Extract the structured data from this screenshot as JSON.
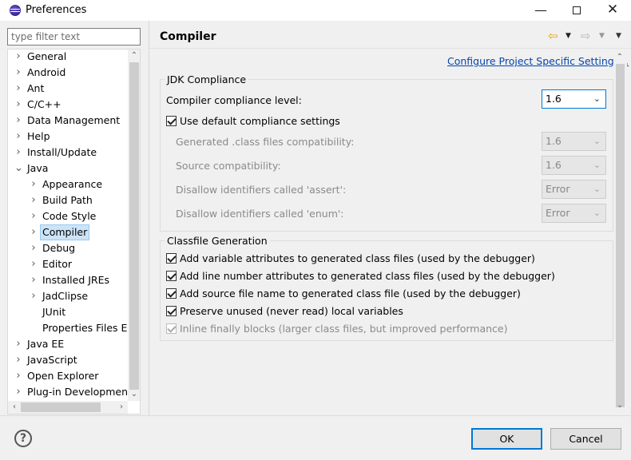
{
  "window": {
    "title": "Preferences",
    "minimize": "—",
    "close": "✕"
  },
  "filter": {
    "placeholder": "type filter text"
  },
  "tree": {
    "items": [
      {
        "label": "General",
        "level": 0,
        "expander": "collapsed"
      },
      {
        "label": "Android",
        "level": 0,
        "expander": "collapsed"
      },
      {
        "label": "Ant",
        "level": 0,
        "expander": "collapsed"
      },
      {
        "label": "C/C++",
        "level": 0,
        "expander": "collapsed"
      },
      {
        "label": "Data Management",
        "level": 0,
        "expander": "collapsed"
      },
      {
        "label": "Help",
        "level": 0,
        "expander": "collapsed"
      },
      {
        "label": "Install/Update",
        "level": 0,
        "expander": "collapsed"
      },
      {
        "label": "Java",
        "level": 0,
        "expander": "expanded"
      },
      {
        "label": "Appearance",
        "level": 1,
        "expander": "collapsed"
      },
      {
        "label": "Build Path",
        "level": 1,
        "expander": "collapsed"
      },
      {
        "label": "Code Style",
        "level": 1,
        "expander": "collapsed"
      },
      {
        "label": "Compiler",
        "level": 1,
        "expander": "collapsed",
        "selected": true
      },
      {
        "label": "Debug",
        "level": 1,
        "expander": "collapsed"
      },
      {
        "label": "Editor",
        "level": 1,
        "expander": "collapsed"
      },
      {
        "label": "Installed JREs",
        "level": 1,
        "expander": "collapsed"
      },
      {
        "label": "JadClipse",
        "level": 1,
        "expander": "collapsed"
      },
      {
        "label": "JUnit",
        "level": 1,
        "expander": "none"
      },
      {
        "label": "Properties Files Ed",
        "level": 1,
        "expander": "none"
      },
      {
        "label": "Java EE",
        "level": 0,
        "expander": "collapsed"
      },
      {
        "label": "JavaScript",
        "level": 0,
        "expander": "collapsed"
      },
      {
        "label": "Open Explorer",
        "level": 0,
        "expander": "collapsed"
      },
      {
        "label": "Plug-in Development",
        "level": 0,
        "expander": "collapsed"
      }
    ]
  },
  "page": {
    "title": "Compiler",
    "link": "Configure Project Specific Settings...",
    "jdk_group": {
      "title": "JDK Compliance",
      "compliance_label": "Compiler compliance level:",
      "compliance_value": "1.6",
      "use_default_label": "Use default compliance settings",
      "use_default_checked": true,
      "rows": [
        {
          "label": "Generated .class files compatibility:",
          "value": "1.6"
        },
        {
          "label": "Source compatibility:",
          "value": "1.6"
        },
        {
          "label": "Disallow identifiers called 'assert':",
          "value": "Error"
        },
        {
          "label": "Disallow identifiers called 'enum':",
          "value": "Error"
        }
      ]
    },
    "classfile_group": {
      "title": "Classfile Generation",
      "options": [
        {
          "label": "Add variable attributes to generated class files (used by the debugger)",
          "checked": true,
          "enabled": true
        },
        {
          "label": "Add line number attributes to generated class files (used by the debugger)",
          "checked": true,
          "enabled": true
        },
        {
          "label": "Add source file name to generated class file (used by the debugger)",
          "checked": true,
          "enabled": true
        },
        {
          "label": "Preserve unused (never read) local variables",
          "checked": true,
          "enabled": true
        },
        {
          "label": "Inline finally blocks (larger class files, but improved performance)",
          "checked": true,
          "enabled": false
        }
      ]
    }
  },
  "footer": {
    "help": "?",
    "ok_label": "OK",
    "cancel_label": "Cancel"
  }
}
